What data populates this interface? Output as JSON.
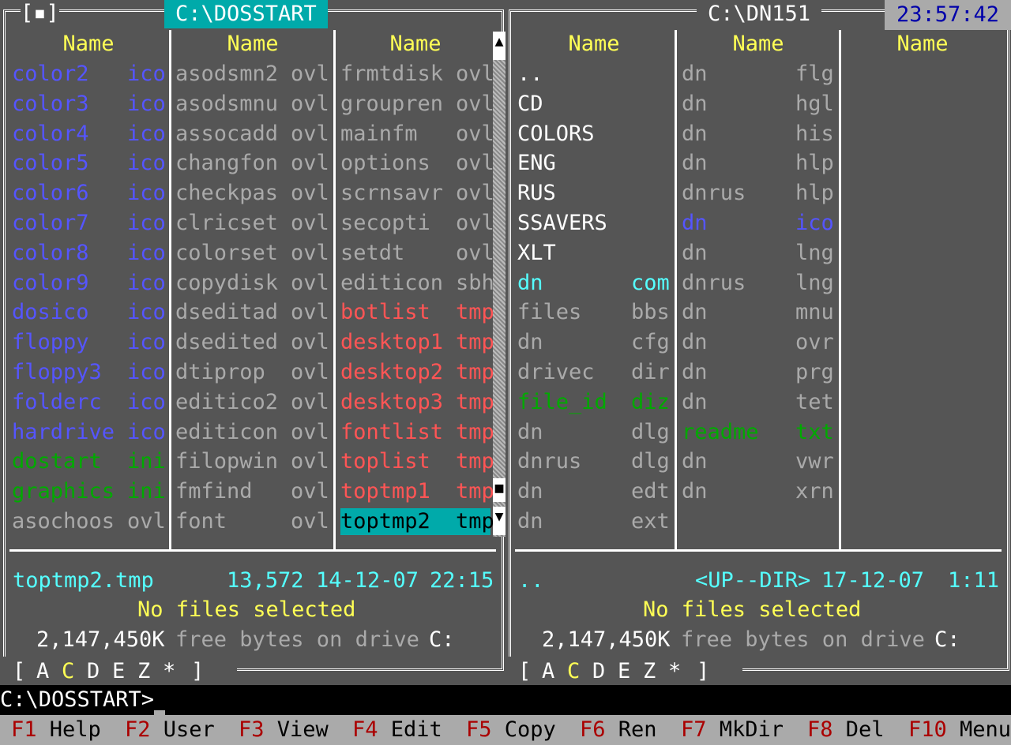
{
  "left_panel": {
    "title": "C:\\DOSSTART",
    "indicator": "[▪]",
    "headers": [
      "Name",
      "Name",
      "Name"
    ],
    "columns": [
      [
        {
          "name": "color2",
          "ext": "ico",
          "color": "#5555ff"
        },
        {
          "name": "color3",
          "ext": "ico",
          "color": "#5555ff"
        },
        {
          "name": "color4",
          "ext": "ico",
          "color": "#5555ff"
        },
        {
          "name": "color5",
          "ext": "ico",
          "color": "#5555ff"
        },
        {
          "name": "color6",
          "ext": "ico",
          "color": "#5555ff"
        },
        {
          "name": "color7",
          "ext": "ico",
          "color": "#5555ff"
        },
        {
          "name": "color8",
          "ext": "ico",
          "color": "#5555ff"
        },
        {
          "name": "color9",
          "ext": "ico",
          "color": "#5555ff"
        },
        {
          "name": "dosico",
          "ext": "ico",
          "color": "#5555ff"
        },
        {
          "name": "floppy",
          "ext": "ico",
          "color": "#5555ff"
        },
        {
          "name": "floppy3",
          "ext": "ico",
          "color": "#5555ff"
        },
        {
          "name": "folderc",
          "ext": "ico",
          "color": "#5555ff"
        },
        {
          "name": "hardrive",
          "ext": "ico",
          "color": "#5555ff"
        },
        {
          "name": "dostart",
          "ext": "ini",
          "color": "#00aa00"
        },
        {
          "name": "graphics",
          "ext": "ini",
          "color": "#00aa00"
        },
        {
          "name": "asochoos",
          "ext": "ovl",
          "color": "#aaaaaa"
        }
      ],
      [
        {
          "name": "asodsmn2",
          "ext": "ovl",
          "color": "#aaaaaa"
        },
        {
          "name": "asodsmnu",
          "ext": "ovl",
          "color": "#aaaaaa"
        },
        {
          "name": "assocadd",
          "ext": "ovl",
          "color": "#aaaaaa"
        },
        {
          "name": "changfon",
          "ext": "ovl",
          "color": "#aaaaaa"
        },
        {
          "name": "checkpas",
          "ext": "ovl",
          "color": "#aaaaaa"
        },
        {
          "name": "clricset",
          "ext": "ovl",
          "color": "#aaaaaa"
        },
        {
          "name": "colorset",
          "ext": "ovl",
          "color": "#aaaaaa"
        },
        {
          "name": "copydisk",
          "ext": "ovl",
          "color": "#aaaaaa"
        },
        {
          "name": "dseditad",
          "ext": "ovl",
          "color": "#aaaaaa"
        },
        {
          "name": "dsedited",
          "ext": "ovl",
          "color": "#aaaaaa"
        },
        {
          "name": "dtiprop",
          "ext": "ovl",
          "color": "#aaaaaa"
        },
        {
          "name": "editico2",
          "ext": "ovl",
          "color": "#aaaaaa"
        },
        {
          "name": "editicon",
          "ext": "ovl",
          "color": "#aaaaaa"
        },
        {
          "name": "filopwin",
          "ext": "ovl",
          "color": "#aaaaaa"
        },
        {
          "name": "fmfind",
          "ext": "ovl",
          "color": "#aaaaaa"
        },
        {
          "name": "font",
          "ext": "ovl",
          "color": "#aaaaaa"
        }
      ],
      [
        {
          "name": "frmtdisk",
          "ext": "ovl",
          "color": "#aaaaaa"
        },
        {
          "name": "groupren",
          "ext": "ovl",
          "color": "#aaaaaa"
        },
        {
          "name": "mainfm",
          "ext": "ovl",
          "color": "#aaaaaa"
        },
        {
          "name": "options",
          "ext": "ovl",
          "color": "#aaaaaa"
        },
        {
          "name": "scrnsavr",
          "ext": "ovl",
          "color": "#aaaaaa"
        },
        {
          "name": "secopti",
          "ext": "ovl",
          "color": "#aaaaaa"
        },
        {
          "name": "setdt",
          "ext": "ovl",
          "color": "#aaaaaa"
        },
        {
          "name": "editicon",
          "ext": "sbh",
          "color": "#aaaaaa"
        },
        {
          "name": "botlist",
          "ext": "tmp",
          "color": "#ff5555"
        },
        {
          "name": "desktop1",
          "ext": "tmp",
          "color": "#ff5555"
        },
        {
          "name": "desktop2",
          "ext": "tmp",
          "color": "#ff5555"
        },
        {
          "name": "desktop3",
          "ext": "tmp",
          "color": "#ff5555"
        },
        {
          "name": "fontlist",
          "ext": "tmp",
          "color": "#ff5555"
        },
        {
          "name": "toplist",
          "ext": "tmp",
          "color": "#ff5555"
        },
        {
          "name": "toptmp1",
          "ext": "tmp",
          "color": "#ff5555"
        },
        {
          "name": "toptmp2",
          "ext": "tmp",
          "color": "#000000",
          "selected": true
        }
      ]
    ],
    "status": {
      "filename": "toptmp2.tmp",
      "size": "13,572",
      "date": "14-12-07",
      "time": "22:15",
      "selection": "No files selected",
      "free_value": "2,147,450K",
      "free_label": "free bytes on drive",
      "drive": "C:"
    },
    "drives": {
      "open": "[",
      "items": [
        "A",
        "C",
        "D",
        "E",
        "Z",
        "*"
      ],
      "close": "]",
      "current": "C"
    }
  },
  "right_panel": {
    "title": "C:\\DN151",
    "clock": "23:57:42",
    "headers": [
      "Name",
      "Name",
      "Name"
    ],
    "columns": [
      [
        {
          "name": "..",
          "ext": "",
          "color": "#ffffff"
        },
        {
          "name": "CD",
          "ext": "",
          "color": "#ffffff"
        },
        {
          "name": "COLORS",
          "ext": "",
          "color": "#ffffff"
        },
        {
          "name": "ENG",
          "ext": "",
          "color": "#ffffff"
        },
        {
          "name": "RUS",
          "ext": "",
          "color": "#ffffff"
        },
        {
          "name": "SSAVERS",
          "ext": "",
          "color": "#ffffff"
        },
        {
          "name": "XLT",
          "ext": "",
          "color": "#ffffff"
        },
        {
          "name": "dn",
          "ext": "com",
          "color": "#55ffff"
        },
        {
          "name": "files",
          "ext": "bbs",
          "color": "#aaaaaa"
        },
        {
          "name": "dn",
          "ext": "cfg",
          "color": "#aaaaaa"
        },
        {
          "name": "drivec",
          "ext": "dir",
          "color": "#aaaaaa"
        },
        {
          "name": "file_id",
          "ext": "diz",
          "color": "#00aa00"
        },
        {
          "name": "dn",
          "ext": "dlg",
          "color": "#aaaaaa"
        },
        {
          "name": "dnrus",
          "ext": "dlg",
          "color": "#aaaaaa"
        },
        {
          "name": "dn",
          "ext": "edt",
          "color": "#aaaaaa"
        },
        {
          "name": "dn",
          "ext": "ext",
          "color": "#aaaaaa"
        }
      ],
      [
        {
          "name": "dn",
          "ext": "flg",
          "color": "#aaaaaa"
        },
        {
          "name": "dn",
          "ext": "hgl",
          "color": "#aaaaaa"
        },
        {
          "name": "dn",
          "ext": "his",
          "color": "#aaaaaa"
        },
        {
          "name": "dn",
          "ext": "hlp",
          "color": "#aaaaaa"
        },
        {
          "name": "dnrus",
          "ext": "hlp",
          "color": "#aaaaaa"
        },
        {
          "name": "dn",
          "ext": "ico",
          "color": "#5555ff"
        },
        {
          "name": "dn",
          "ext": "lng",
          "color": "#aaaaaa"
        },
        {
          "name": "dnrus",
          "ext": "lng",
          "color": "#aaaaaa"
        },
        {
          "name": "dn",
          "ext": "mnu",
          "color": "#aaaaaa"
        },
        {
          "name": "dn",
          "ext": "ovr",
          "color": "#aaaaaa"
        },
        {
          "name": "dn",
          "ext": "prg",
          "color": "#aaaaaa"
        },
        {
          "name": "dn",
          "ext": "tet",
          "color": "#aaaaaa"
        },
        {
          "name": "readme",
          "ext": "txt",
          "color": "#00aa00"
        },
        {
          "name": "dn",
          "ext": "vwr",
          "color": "#aaaaaa"
        },
        {
          "name": "dn",
          "ext": "xrn",
          "color": "#aaaaaa"
        }
      ],
      []
    ],
    "status": {
      "filename": "..",
      "size": "<UP--DIR>",
      "date": "17-12-07",
      "time": "1:11",
      "selection": "No files selected",
      "free_value": "2,147,450K",
      "free_label": "free bytes on drive",
      "drive": "C:"
    },
    "drives": {
      "open": "[",
      "items": [
        "A",
        "C",
        "D",
        "E",
        "Z",
        "*"
      ],
      "close": "]",
      "current": "C"
    }
  },
  "command_line": {
    "prompt": "C:\\DOSSTART>",
    "value": ""
  },
  "key_bar": [
    {
      "key": "F1",
      "label": "Help"
    },
    {
      "key": "F2",
      "label": "User"
    },
    {
      "key": "F3",
      "label": "View"
    },
    {
      "key": "F4",
      "label": "Edit"
    },
    {
      "key": "F5",
      "label": "Copy"
    },
    {
      "key": "F6",
      "label": "Ren"
    },
    {
      "key": "F7",
      "label": "MkDir"
    },
    {
      "key": "F8",
      "label": "Del"
    },
    {
      "key": "F10",
      "label": "Menu"
    }
  ],
  "scrollbar": {
    "up_icon": "arrow-up-icon",
    "down_icon": "arrow-down-icon",
    "thumb_icon": "scroll-thumb-icon"
  }
}
